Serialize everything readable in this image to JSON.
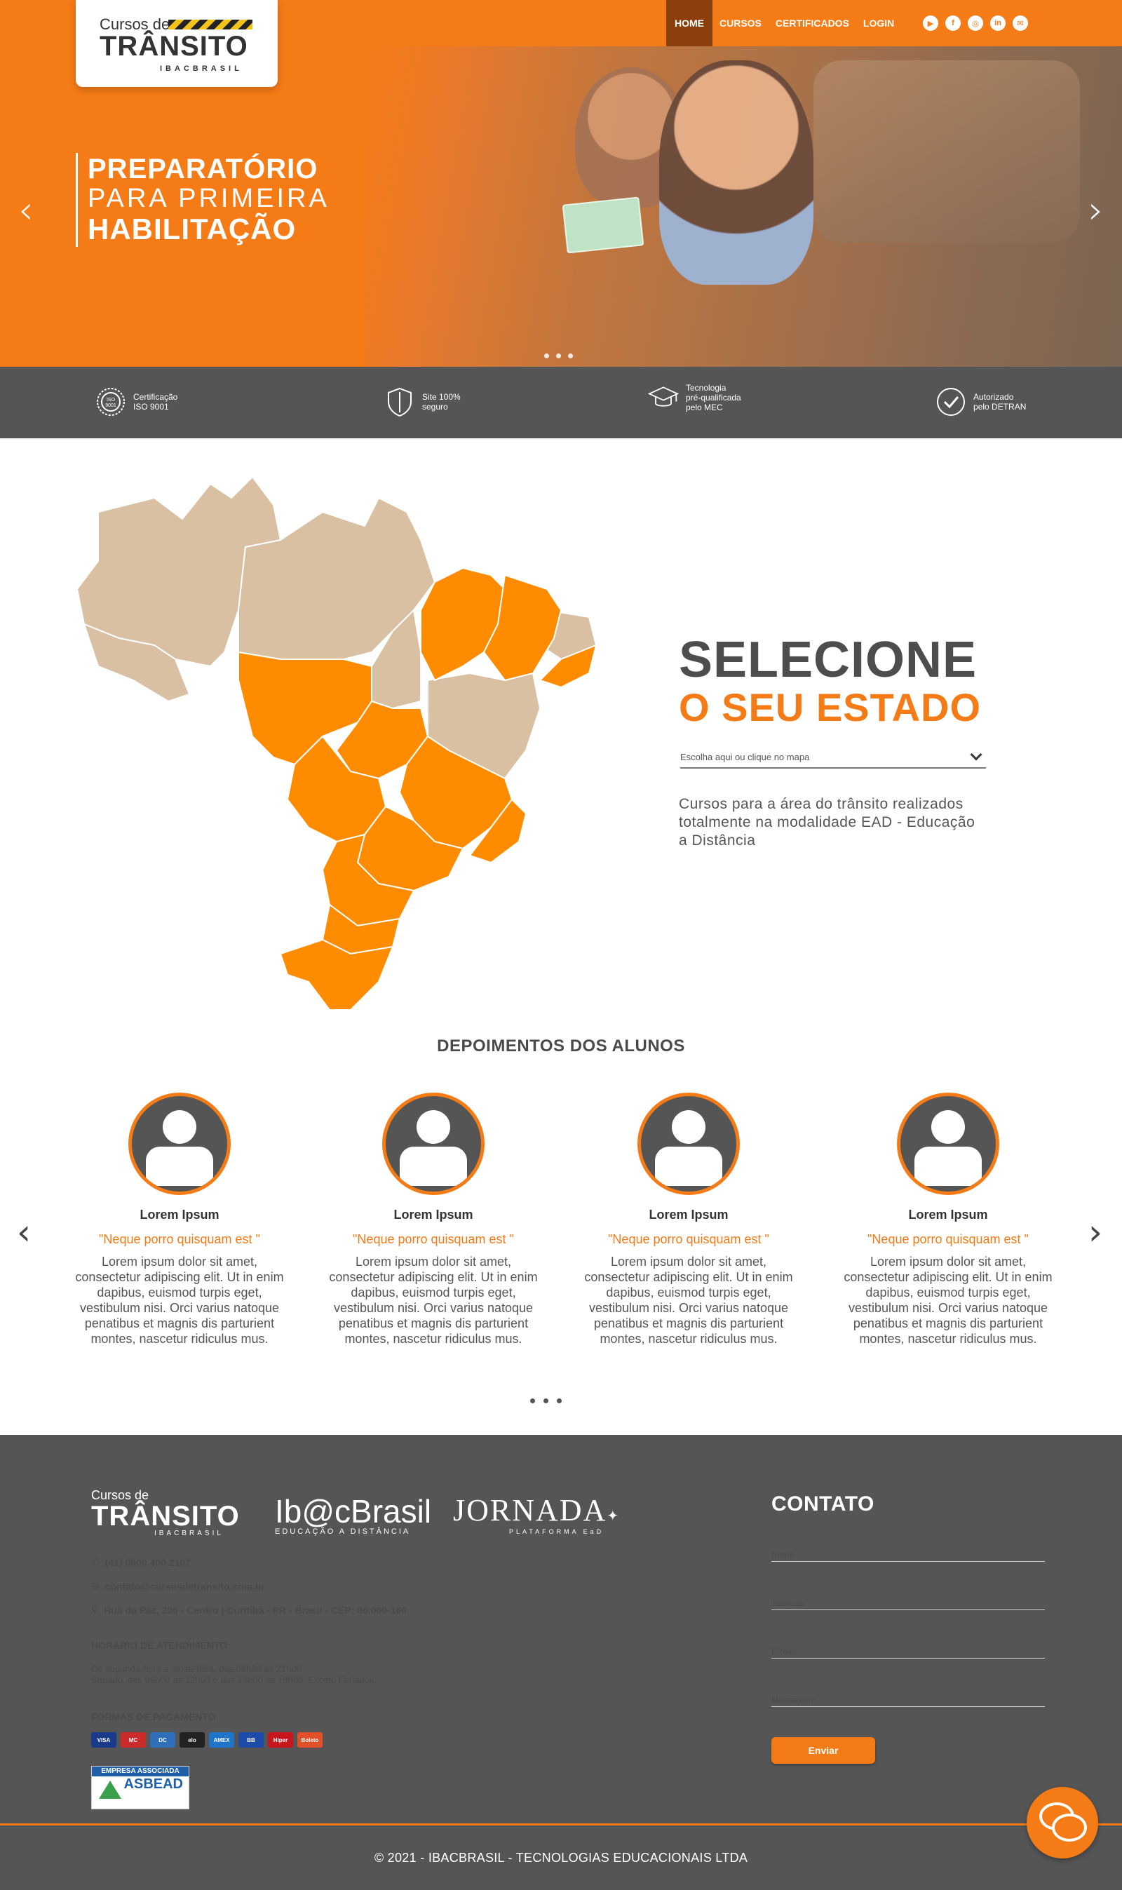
{
  "brand": {
    "logo_small": "Cursos de",
    "logo_big": "TRÂNSITO",
    "logo_sub": "IBACBRASIL",
    "accent": "#f57b16",
    "dark": "#555555"
  },
  "nav": {
    "items": [
      {
        "label": "HOME",
        "active": true
      },
      {
        "label": "CURSOS"
      },
      {
        "label": "CERTIFICADOS"
      },
      {
        "label": "LOGIN"
      }
    ],
    "social": [
      "youtube-icon",
      "facebook-icon",
      "instagram-icon",
      "linkedin-icon",
      "email-icon"
    ]
  },
  "hero": {
    "line1": "PREPARATÓRIO",
    "line2": "PARA PRIMEIRA",
    "line3": "HABILITAÇÃO",
    "slide_count": 3
  },
  "features": [
    {
      "icon": "iso-badge-icon",
      "text": "Certificação\nISO 9001"
    },
    {
      "icon": "shield-icon",
      "text": "Site 100%\nseguro"
    },
    {
      "icon": "graduation-cap-icon",
      "text": "Tecnologia\npré-qualificada\npelo MEC"
    },
    {
      "icon": "check-circle-icon",
      "text": "Autorizado\npelo DETRAN"
    }
  ],
  "state_select": {
    "title": "SELECIONE",
    "subtitle": "O SEU ESTADO",
    "placeholder": "Escolha aqui ou clique no mapa",
    "description": "Cursos para a área do trânsito realizados totalmente na modalidade EAD - Educação a Distância"
  },
  "testimonials": {
    "title": "DEPOIMENTOS DOS ALUNOS",
    "items": [
      {
        "name": "Lorem Ipsum",
        "quote": "\"Neque porro quisquam est \"",
        "text": "Lorem ipsum dolor sit amet, consectetur adipiscing elit. Ut in enim dapibus, euismod turpis eget, vestibulum nisi. Orci varius natoque penatibus et magnis dis parturient montes, nascetur ridiculus mus."
      },
      {
        "name": "Lorem Ipsum",
        "quote": "\"Neque porro quisquam est \"",
        "text": "Lorem ipsum dolor sit amet, consectetur adipiscing elit. Ut in enim dapibus, euismod turpis eget, vestibulum nisi. Orci varius natoque penatibus et magnis dis parturient montes, nascetur ridiculus mus."
      },
      {
        "name": "Lorem Ipsum",
        "quote": "\"Neque porro quisquam est \"",
        "text": "Lorem ipsum dolor sit amet, consectetur adipiscing elit. Ut in enim dapibus, euismod turpis eget, vestibulum nisi. Orci varius natoque penatibus et magnis dis parturient montes, nascetur ridiculus mus."
      },
      {
        "name": "Lorem Ipsum",
        "quote": "\"Neque porro quisquam est \"",
        "text": "Lorem ipsum dolor sit amet, consectetur adipiscing elit. Ut in enim dapibus, euismod turpis eget, vestibulum nisi. Orci varius natoque penatibus et magnis dis parturient montes, nascetur ridiculus mus."
      }
    ]
  },
  "footer": {
    "logo2": "Ib@cBrasil",
    "logo2_sub": "EDUCAÇÃO A DISTÂNCIA",
    "logo3": "JORNADA",
    "logo3_sub": "PLATAFORMA EaD",
    "phone": "(41)  0800 400 2107",
    "email": "contato@cursosdetransito.com.br",
    "address": "Rua da Paz, 236 - Centro | Curitiba - PR - Brasil - CEP: 80.060-160",
    "hours_title": "HORÁRIO DE ATENDIMENTO:",
    "hours_line1": "De segunda-feira a sexta-feira, das 08h30 às 21h00.",
    "hours_line2": "Sábado, das 09h00 às 12h00 e das 13h00 às 18h00. Exceto Feriados.",
    "payments_title": "FORMAS DE PAGAMENTO",
    "payments": [
      {
        "label": "VISA",
        "color": "#1a3b8b"
      },
      {
        "label": "MC",
        "color": "#cc2b2b"
      },
      {
        "label": "DC",
        "color": "#2f6fb8"
      },
      {
        "label": "elo",
        "color": "#222222"
      },
      {
        "label": "AMEX",
        "color": "#1e74c8"
      },
      {
        "label": "BB",
        "color": "#1e4aa8"
      },
      {
        "label": "Hiper",
        "color": "#c9161c"
      },
      {
        "label": "Boleto",
        "color": "#e2502a"
      }
    ],
    "asbead_top": "EMPRESA ASSOCIADA",
    "asbead_name": "ASBEAD",
    "contact_title": "CONTATO",
    "field_name": "Nome:",
    "field_phone": "Telefone:",
    "field_email": "E-mail:",
    "field_message": "Mensagem:",
    "send": "Enviar",
    "copyright": "© 2021 -  IBACBRASIL - TECNOLOGIAS EDUCACIONAIS LTDA"
  }
}
